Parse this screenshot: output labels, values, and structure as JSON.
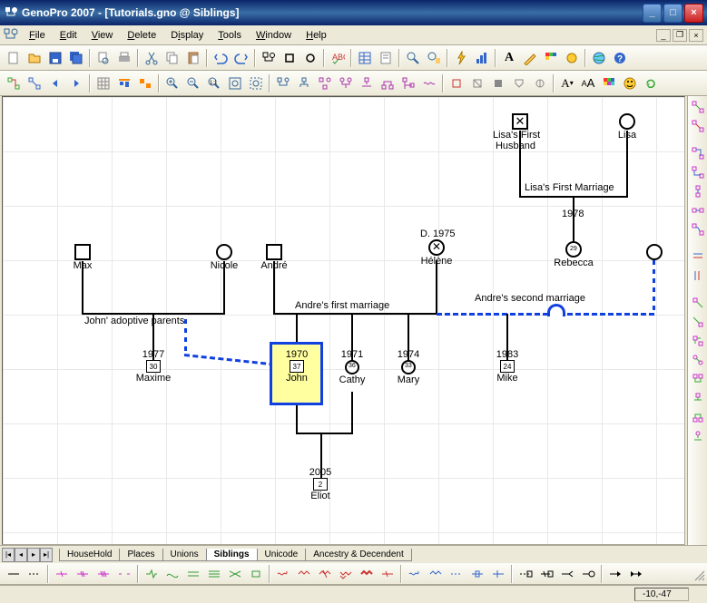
{
  "title": "GenoPro 2007 - [Tutorials.gno @ Siblings]",
  "menus": [
    "File",
    "Edit",
    "View",
    "Delete",
    "Display",
    "Tools",
    "Window",
    "Help"
  ],
  "tabs": {
    "items": [
      "HouseHold",
      "Places",
      "Unions",
      "Siblings",
      "Unicode",
      "Ancestry & Decendent"
    ],
    "active": 3
  },
  "status": {
    "coords": "-10,-47"
  },
  "people": {
    "max": "Max",
    "nicole": "Nicole",
    "andre": "André",
    "lisas_first_husband": "Lisa's First\nHusband",
    "lisa": "Lisa",
    "helene": "Hélène",
    "helene_death": "D. 1975",
    "rebecca": "Rebecca",
    "rebecca_age": "29",
    "maxime": "Maxime",
    "maxime_year": "1977",
    "maxime_age": "30",
    "john": "John",
    "john_year": "1970",
    "john_age": "37",
    "cathy": "Cathy",
    "cathy_year": "1971",
    "cathy_age": "36",
    "mary": "Mary",
    "mary_year": "1974",
    "mary_age": "33",
    "mike": "Mike",
    "mike_year": "1983",
    "mike_age": "24",
    "eliot": "Eliot",
    "eliot_year": "2005",
    "eliot_age": "2"
  },
  "marriages": {
    "john_adoptive": "John' adoptive parents",
    "andre_first": "Andre's first marriage",
    "andre_second": "Andre's second marriage",
    "lisa_first": "Lisa's First Marriage",
    "lisa_year": "1978"
  }
}
